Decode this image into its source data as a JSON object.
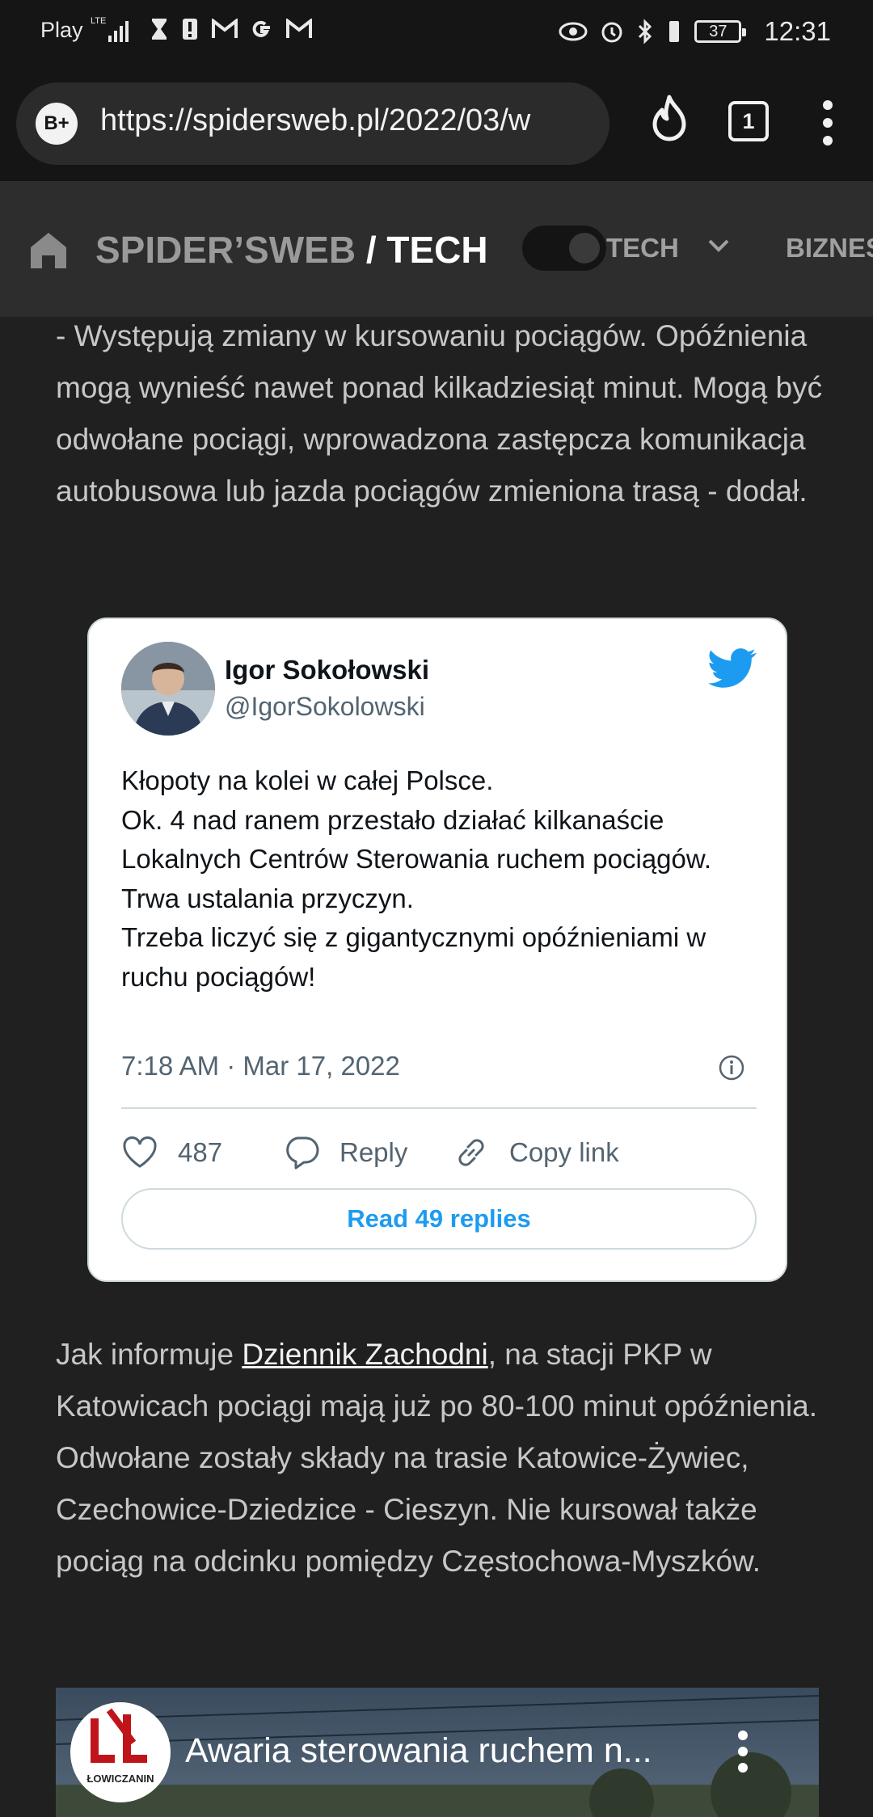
{
  "status_bar": {
    "carrier": "Play",
    "network": "LTE",
    "battery": "37",
    "time": "12:31"
  },
  "browser": {
    "site_badge": "B+",
    "url": "https://spidersweb.pl/2022/03/w",
    "tab_count": "1"
  },
  "site_nav": {
    "logo_left": "SPIDER’SWEB",
    "logo_sep": " / ",
    "logo_right": "TECH",
    "section": "TECH",
    "next_section": "BIZNES"
  },
  "article": {
    "paragraph_1": "- Występują zmiany w kursowaniu pociągów. Opóźnienia mogą wynieść nawet ponad kilkadziesiąt minut. Mogą być odwołane pociągi, wprowadzona zastępcza komunikacja autobusowa lub jazda pociągów zmieniona trasą - dodał.",
    "paragraph_2_prefix": "Jak informuje ",
    "paragraph_2_link": "Dziennik Zachodni",
    "paragraph_2_rest": ", na stacji PKP w Katowicach pociągi mają już po 80-100 minut opóźnienia. Odwołane zostały składy na trasie Katowice-Żywiec, Czechowice-Dziedzice - Cieszyn. Nie kursował także pociąg na odcinku pomiędzy Częstochowa-Myszków."
  },
  "tweet": {
    "author_name": "Igor Sokołowski",
    "author_handle": "@IgorSokolowski",
    "lines": [
      "Kłopoty na kolei w całej Polsce.",
      "Ok. 4 nad ranem przestało działać kilkanaście Lokalnych Centrów Sterowania ruchem pociągów.",
      "Trwa ustalania przyczyn.",
      "Trzeba liczyć się z gigantycznymi opóźnieniami w ruchu pociągów!"
    ],
    "timestamp": "7:18 AM · Mar 17, 2022",
    "likes": "487",
    "reply_label": "Reply",
    "copy_link_label": "Copy link",
    "read_replies_label": "Read 49 replies"
  },
  "video": {
    "channel_logo_text": "ŁOWICZANIN",
    "title": "Awaria sterowania ruchem n..."
  },
  "colors": {
    "page_bg": "#202020",
    "nav_bg": "#2d2d2d",
    "twitter_blue": "#1d9bf0",
    "article_text": "#c7c7c7"
  },
  "icons": [
    "home-icon",
    "fire-icon",
    "more-vert-icon",
    "chevron-down-icon",
    "twitter-bird-icon",
    "info-icon",
    "heart-icon",
    "reply-bubble-icon",
    "link-icon"
  ]
}
